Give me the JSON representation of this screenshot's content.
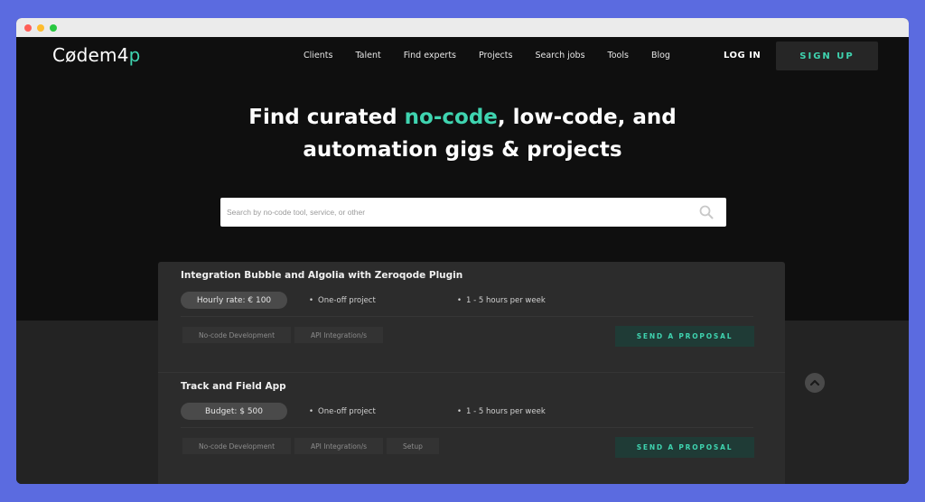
{
  "nav": {
    "logo_prefix": "C",
    "logo_mid": "ødem4",
    "logo_suffix": "p",
    "links": [
      "Clients",
      "Talent",
      "Find experts",
      "Projects",
      "Search jobs",
      "Tools",
      "Blog"
    ],
    "login": "LOG IN",
    "signup": "SIGN UP"
  },
  "hero": {
    "line1_pre": "Find curated ",
    "line1_highlight": "no-code",
    "line1_post": ", low-code, and",
    "line2": "automation gigs & projects"
  },
  "search": {
    "placeholder": "Search by no-code tool, service, or other",
    "icon": "search-icon"
  },
  "jobs": [
    {
      "title": "Integration Bubble and Algolia with Zeroqode Plugin",
      "rate": "Hourly rate: € 100",
      "project_type": "One-off project",
      "hours": "1 - 5 hours per week",
      "tags": [
        "No-code Development",
        "API Integration/s"
      ],
      "action": "SEND A PROPOSAL"
    },
    {
      "title": "Track and Field App",
      "rate": "Budget: $ 500",
      "project_type": "One-off project",
      "hours": "1 - 5 hours per week",
      "tags": [
        "No-code Development",
        "API Integration/s",
        "Setup"
      ],
      "action": "SEND A PROPOSAL"
    }
  ],
  "colors": {
    "accent": "#3fd4b0",
    "background": "#0f0f0f",
    "frame": "#5b6be0"
  },
  "scroll_top_icon": "chevron-up-icon"
}
